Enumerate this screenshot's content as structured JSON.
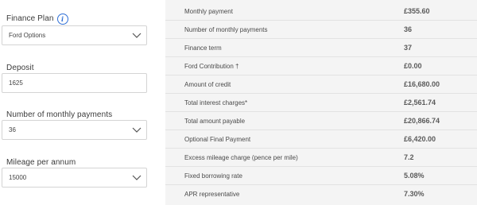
{
  "form": {
    "finance_plan": {
      "label": "Finance Plan",
      "info_icon": "info-icon",
      "value": "Ford Options"
    },
    "deposit": {
      "label": "Deposit",
      "value": "1625"
    },
    "payments": {
      "label": "Number of monthly payments",
      "value": "36"
    },
    "mileage": {
      "label": "Mileage per annum",
      "value": "15000"
    },
    "chevron_icon": "chevron-down-icon"
  },
  "summary": {
    "rows": [
      {
        "label": "Monthly payment",
        "value": "£355.60"
      },
      {
        "label": "Number of monthly payments",
        "value": "36"
      },
      {
        "label": "Finance term",
        "value": "37"
      },
      {
        "label": "Ford Contribution †",
        "value": "£0.00"
      },
      {
        "label": "Amount of credit",
        "value": "£16,680.00"
      },
      {
        "label": "Total interest charges*",
        "value": "£2,561.74"
      },
      {
        "label": "Total amount payable",
        "value": "£20,866.74"
      },
      {
        "label": "Optional Final Payment",
        "value": "£6,420.00"
      },
      {
        "label": "Excess mileage charge (pence per mile)",
        "value": "7.2"
      },
      {
        "label": "Fixed borrowing rate",
        "value": "5.08%"
      },
      {
        "label": "APR representative",
        "value": "7.30%"
      }
    ]
  },
  "colors": {
    "accent": "#2f6fd6",
    "panel_background": "#f4f4f4",
    "border": "#d4d4d4",
    "text": "#3a3a3a"
  }
}
